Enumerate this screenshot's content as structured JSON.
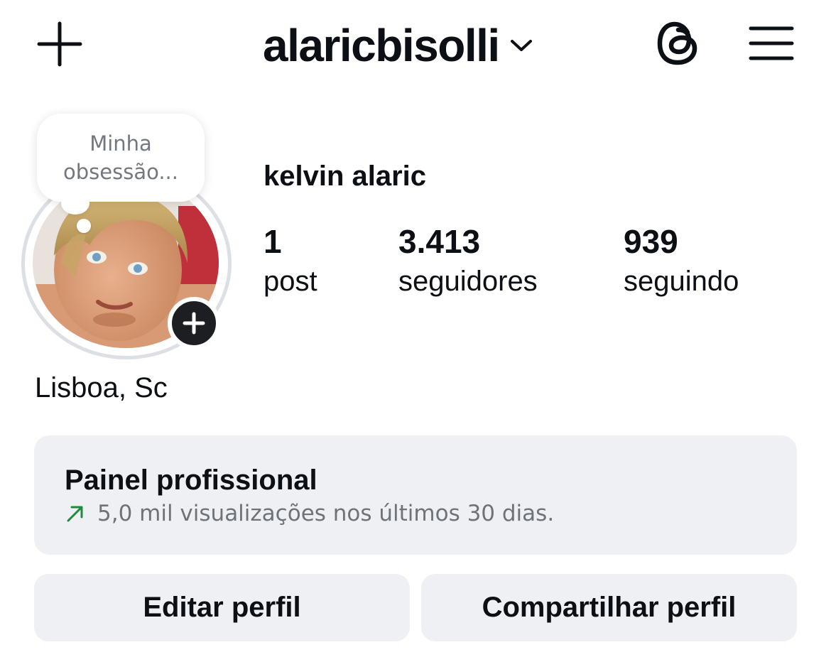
{
  "header": {
    "username": "alaricbisolli",
    "create_icon": "plus-icon",
    "dropdown_icon": "chevron-down-icon",
    "threads_icon": "threads-icon",
    "menu_icon": "hamburger-menu-icon"
  },
  "note": {
    "line1": "Minha",
    "line2": "obsessão..."
  },
  "profile": {
    "display_name": "kelvin alaric",
    "location": "Lisboa, Sc",
    "add_story_icon": "plus-icon"
  },
  "stats": [
    {
      "value": "1",
      "label": "post"
    },
    {
      "value": "3.413",
      "label": "seguidores"
    },
    {
      "value": "939",
      "label": "seguindo"
    }
  ],
  "dashboard": {
    "title": "Painel profissional",
    "subtitle": "5,0 mil visualizações nos últimos 30 dias.",
    "trend_icon": "arrow-up-right-icon",
    "trend_color": "#1f8a3b"
  },
  "actions": {
    "edit_label": "Editar perfil",
    "share_label": "Compartilhar perfil"
  },
  "colors": {
    "button_bg": "#eff0f3",
    "text": "#0c0f14",
    "muted": "#6e737a"
  }
}
